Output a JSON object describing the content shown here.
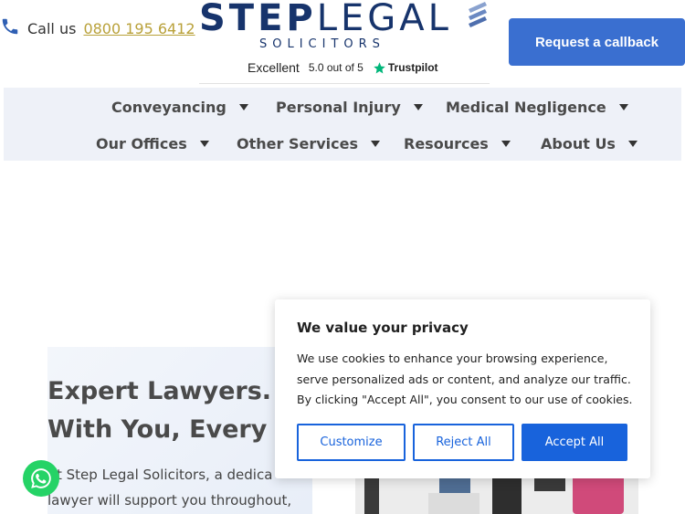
{
  "header": {
    "call_label": "Call us",
    "phone": "0800 195 6412",
    "logo_step": "STEP",
    "logo_legal": "LEGAL",
    "logo_sub": "SOLICITORS",
    "trust_excellent": "Excellent",
    "trust_score": "5.0 out of 5",
    "trust_brand": "Trustpilot",
    "callback_label": "Request a callback"
  },
  "nav": {
    "items": [
      {
        "label": "Conveyancing"
      },
      {
        "label": "Personal Injury"
      },
      {
        "label": "Medical Negligence"
      },
      {
        "label": "Our Offices"
      },
      {
        "label": "Other Services"
      },
      {
        "label": "Resources"
      },
      {
        "label": "About Us"
      }
    ]
  },
  "hero": {
    "heading_line1": "Expert Lawyers.",
    "heading_line2": "With You, Every St",
    "para_line1": "At Step Legal Solicitors, a dedica",
    "para_line2": "lawyer will support you throughout,"
  },
  "cookie": {
    "title": "We value your privacy",
    "text": "We use cookies to enhance your browsing experience, serve personalized ads or content, and analyze our traffic. By clicking \"Accept All\", you consent to our use of cookies.",
    "customize": "Customize",
    "reject": "Reject All",
    "accept": "Accept All"
  },
  "colors": {
    "brand_navy": "#17346c",
    "callback_blue": "#3a6fd0",
    "cookie_blue": "#1863dc",
    "nav_bg": "#eef1f8",
    "whatsapp_green": "#25d366",
    "phone_link": "#b9a13a"
  },
  "icons": {
    "phone": "phone-icon",
    "trustpilot_star": "star-icon",
    "whatsapp": "whatsapp-icon",
    "caret": "caret-down-icon"
  }
}
